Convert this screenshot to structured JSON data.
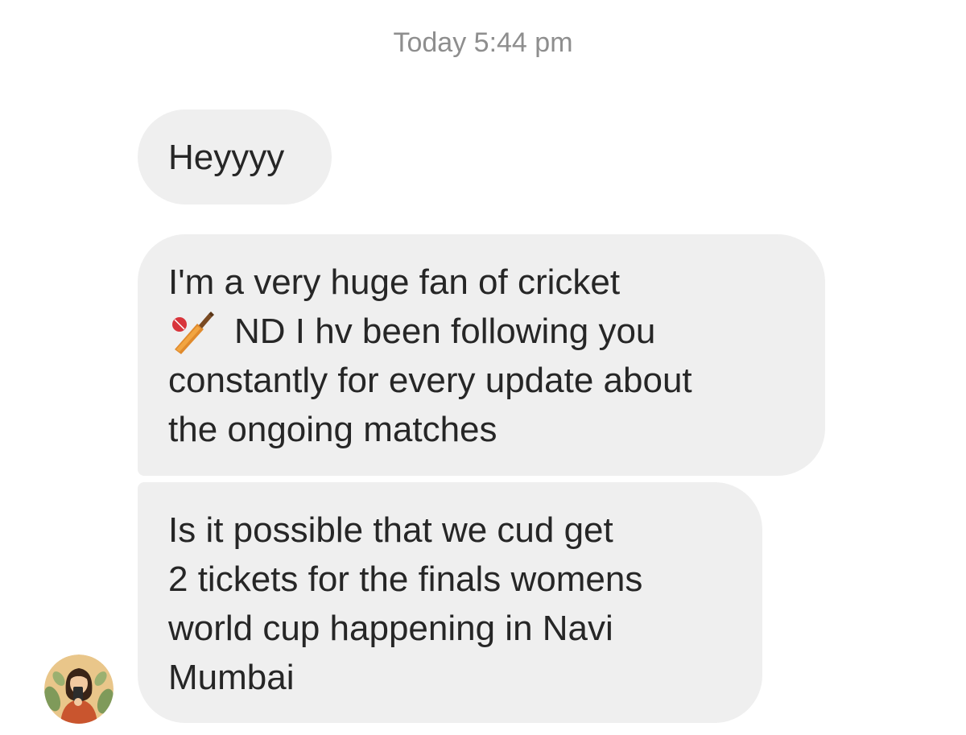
{
  "thread": {
    "timestamp": "Today 5:44 pm"
  },
  "messages": [
    {
      "lines": [
        "Heyyyy"
      ]
    },
    {
      "lines": [
        "I'm a very huge fan of cricket",
        "ND I hv been following you",
        "constantly for every update about",
        "the ongoing matches"
      ],
      "inline_icon": "cricket-bat-and-ball-emoji"
    },
    {
      "lines": [
        "Is it possible that we cud get",
        "2 tickets for the finals womens",
        "world cup happening in Navi",
        "Mumbai"
      ]
    }
  ],
  "sender": {
    "avatar_icon": "illustrated-girl-avatar"
  },
  "colors": {
    "bubble_background": "#efefef",
    "timestamp_text": "#8e8e8e",
    "message_text": "#262626",
    "page_background": "#ffffff"
  }
}
